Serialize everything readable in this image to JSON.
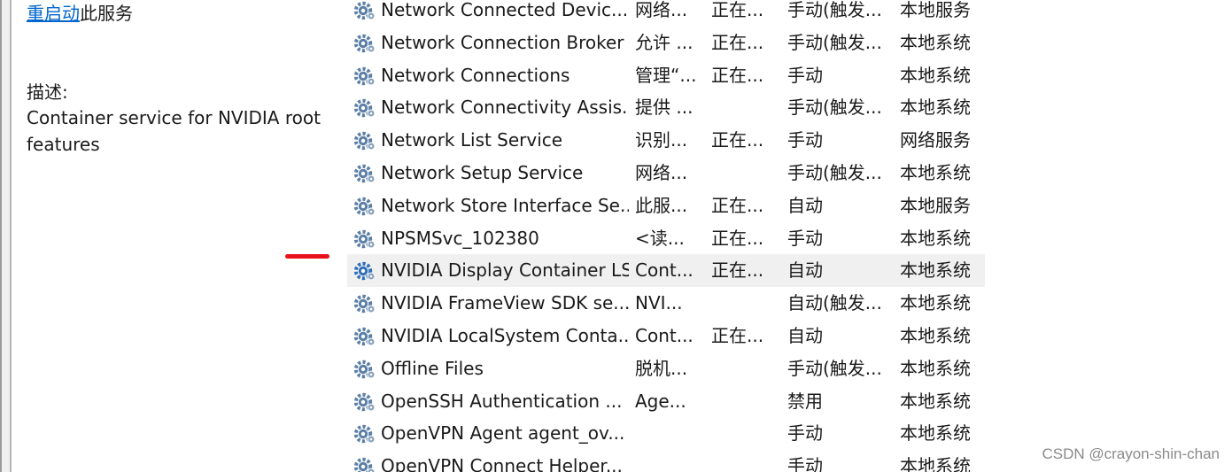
{
  "description_panel": {
    "restart_link": "重启动",
    "restart_suffix": "此服务",
    "desc_label": "描述:",
    "desc_text": "Container service for NVIDIA root features"
  },
  "services": [
    {
      "name": "Network Connected Devic...",
      "description": "网络...",
      "status": "正在...",
      "startup": "手动(触发...",
      "logon": "本地服务",
      "selected": false
    },
    {
      "name": "Network Connection Broker",
      "description": "允许 ...",
      "status": "正在...",
      "startup": "手动(触发...",
      "logon": "本地系统",
      "selected": false
    },
    {
      "name": "Network Connections",
      "description": "管理“...",
      "status": "正在...",
      "startup": "手动",
      "logon": "本地系统",
      "selected": false
    },
    {
      "name": "Network Connectivity Assis...",
      "description": "提供 ...",
      "status": "",
      "startup": "手动(触发...",
      "logon": "本地系统",
      "selected": false
    },
    {
      "name": "Network List Service",
      "description": "识别...",
      "status": "正在...",
      "startup": "手动",
      "logon": "网络服务",
      "selected": false
    },
    {
      "name": "Network Setup Service",
      "description": "网络...",
      "status": "",
      "startup": "手动(触发...",
      "logon": "本地系统",
      "selected": false
    },
    {
      "name": "Network Store Interface Se...",
      "description": "此服...",
      "status": "正在...",
      "startup": "自动",
      "logon": "本地服务",
      "selected": false
    },
    {
      "name": "NPSMSvc_102380",
      "description": "<读...",
      "status": "正在...",
      "startup": "手动",
      "logon": "本地系统",
      "selected": false
    },
    {
      "name": "NVIDIA Display Container LS",
      "description": "Cont...",
      "status": "正在...",
      "startup": "自动",
      "logon": "本地系统",
      "selected": true
    },
    {
      "name": "NVIDIA FrameView SDK se...",
      "description": "NVI...",
      "status": "",
      "startup": "自动(触发...",
      "logon": "本地系统",
      "selected": false
    },
    {
      "name": "NVIDIA LocalSystem Conta...",
      "description": "Cont...",
      "status": "正在...",
      "startup": "自动",
      "logon": "本地系统",
      "selected": false
    },
    {
      "name": "Offline Files",
      "description": "脱机...",
      "status": "",
      "startup": "手动(触发...",
      "logon": "本地系统",
      "selected": false
    },
    {
      "name": "OpenSSH Authentication ...",
      "description": "Age...",
      "status": "",
      "startup": "禁用",
      "logon": "本地系统",
      "selected": false
    },
    {
      "name": "OpenVPN Agent agent_ov...",
      "description": "",
      "status": "",
      "startup": "手动",
      "logon": "本地系统",
      "selected": false
    },
    {
      "name": "OpenVPN Connect Helper...",
      "description": "",
      "status": "",
      "startup": "手动",
      "logon": "本地系统",
      "selected": false
    }
  ],
  "watermark": "CSDN @crayon-shin-chan",
  "colors": {
    "link": "#0066cc",
    "selected_row": "#f0f0f0",
    "annotation_mark": "#e8131a",
    "gear_icon": "#5b7fa6",
    "gear_icon_selected": "#2f6fb8"
  }
}
